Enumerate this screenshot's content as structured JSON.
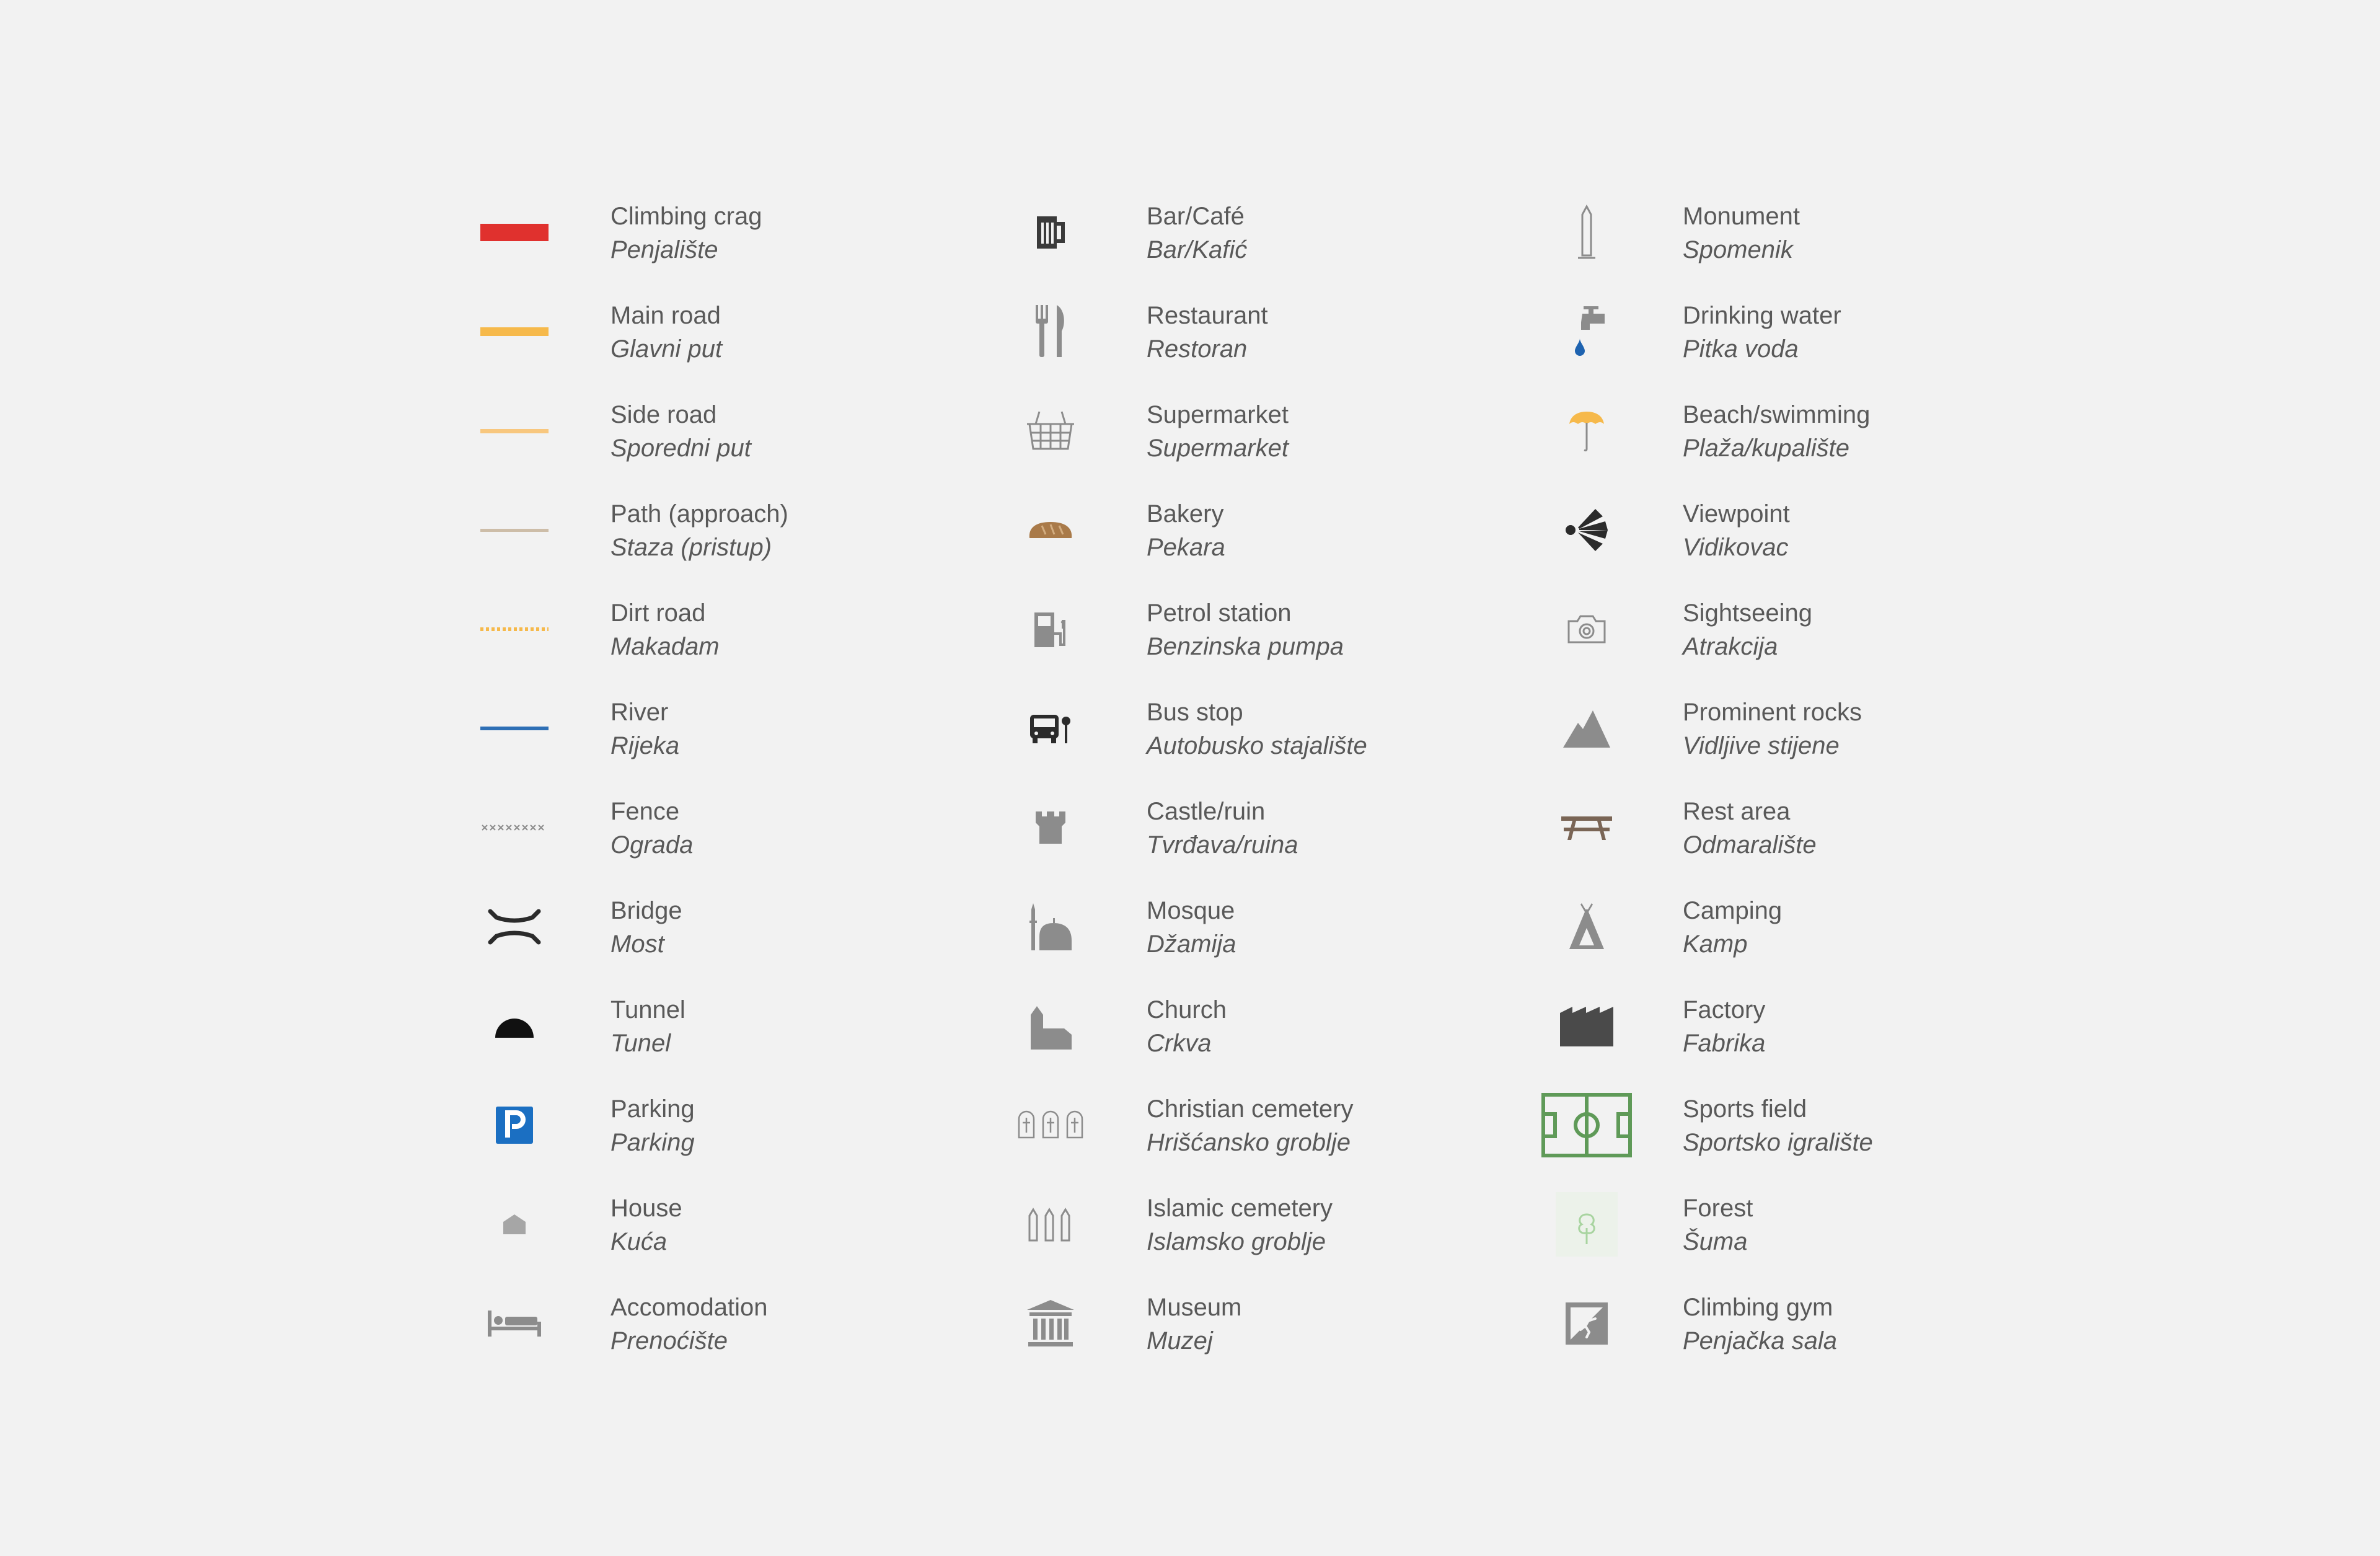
{
  "legend": {
    "columns": [
      [
        {
          "id": "climbing-crag",
          "en": "Climbing crag",
          "hr": "Penjalište",
          "icon": "red-thick-line",
          "color": "#e0312e"
        },
        {
          "id": "main-road",
          "en": "Main road",
          "hr": "Glavni put",
          "icon": "orange-thick-line",
          "color": "#f6b94b"
        },
        {
          "id": "side-road",
          "en": "Side road",
          "hr": "Sporedni put",
          "icon": "light-orange-line",
          "color": "#f8c77e"
        },
        {
          "id": "path",
          "en": "Path (approach)",
          "hr": "Staza (pristup)",
          "icon": "tan-line",
          "color": "#cdbda8"
        },
        {
          "id": "dirt-road",
          "en": "Dirt road",
          "hr": "Makadam",
          "icon": "dotted-orange-line",
          "color": "#f6b94b"
        },
        {
          "id": "river",
          "en": "River",
          "hr": "Rijeka",
          "icon": "blue-line",
          "color": "#2e6fb5"
        },
        {
          "id": "fence",
          "en": "Fence",
          "hr": "Ograda",
          "icon": "cross-line",
          "color": "#8c8c8c"
        },
        {
          "id": "bridge",
          "en": "Bridge",
          "hr": "Most",
          "icon": "bridge-icon",
          "color": "#2b2b2b"
        },
        {
          "id": "tunnel",
          "en": "Tunnel",
          "hr": "Tunel",
          "icon": "tunnel-icon",
          "color": "#111111"
        },
        {
          "id": "parking",
          "en": "Parking",
          "hr": "Parking",
          "icon": "parking-icon",
          "color": "#1b6fc2"
        },
        {
          "id": "house",
          "en": "House",
          "hr": "Kuća",
          "icon": "house-icon",
          "color": "#a6a6a6"
        },
        {
          "id": "accomodation",
          "en": "Accomodation",
          "hr": "Prenoćište",
          "icon": "bed-icon",
          "color": "#8c8c8c"
        }
      ],
      [
        {
          "id": "bar",
          "en": "Bar/Café",
          "hr": "Bar/Kafić",
          "icon": "beer-mug-icon",
          "color": "#3a3a3a"
        },
        {
          "id": "restaurant",
          "en": "Restaurant",
          "hr": "Restoran",
          "icon": "cutlery-icon",
          "color": "#8c8c8c"
        },
        {
          "id": "supermarket",
          "en": "Supermarket",
          "hr": "Supermarket",
          "icon": "basket-icon",
          "color": "#8c8c8c"
        },
        {
          "id": "bakery",
          "en": "Bakery",
          "hr": "Pekara",
          "icon": "bread-icon",
          "color": "#a97a49"
        },
        {
          "id": "petrol",
          "en": "Petrol station",
          "hr": "Benzinska pumpa",
          "icon": "fuel-pump-icon",
          "color": "#8c8c8c"
        },
        {
          "id": "bus-stop",
          "en": "Bus stop",
          "hr": "Autobusko stajalište",
          "icon": "bus-icon",
          "color": "#2b2b2b"
        },
        {
          "id": "castle",
          "en": "Castle/ruin",
          "hr": "Tvrđava/ruina",
          "icon": "castle-icon",
          "color": "#8c8c8c"
        },
        {
          "id": "mosque",
          "en": "Mosque",
          "hr": "Džamija",
          "icon": "mosque-icon",
          "color": "#8c8c8c"
        },
        {
          "id": "church",
          "en": "Church",
          "hr": "Crkva",
          "icon": "church-icon",
          "color": "#8c8c8c"
        },
        {
          "id": "christian-cemetery",
          "en": "Christian cemetery",
          "hr": "Hrišćansko groblje",
          "icon": "cross-graves-icon",
          "color": "#8c8c8c"
        },
        {
          "id": "islamic-cemetery",
          "en": "Islamic cemetery",
          "hr": "Islamsko groblje",
          "icon": "pointed-graves-icon",
          "color": "#8c8c8c"
        },
        {
          "id": "museum",
          "en": "Museum",
          "hr": "Muzej",
          "icon": "museum-icon",
          "color": "#8c8c8c"
        }
      ],
      [
        {
          "id": "monument",
          "en": "Monument",
          "hr": "Spomenik",
          "icon": "obelisk-icon",
          "color": "#8c8c8c"
        },
        {
          "id": "drinking-water",
          "en": "Drinking water",
          "hr": "Pitka voda",
          "icon": "tap-icon",
          "color": "#8c8c8c"
        },
        {
          "id": "beach",
          "en": "Beach/swimming",
          "hr": "Plaža/kupalište",
          "icon": "umbrella-icon",
          "color": "#f6b94b"
        },
        {
          "id": "viewpoint",
          "en": "Viewpoint",
          "hr": "Vidikovac",
          "icon": "viewpoint-icon",
          "color": "#2b2b2b"
        },
        {
          "id": "sightseeing",
          "en": "Sightseeing",
          "hr": "Atrakcija",
          "icon": "camera-icon",
          "color": "#8c8c8c"
        },
        {
          "id": "rocks",
          "en": "Prominent rocks",
          "hr": "Vidljive stijene",
          "icon": "mountain-icon",
          "color": "#8c8c8c"
        },
        {
          "id": "rest-area",
          "en": "Rest area",
          "hr": "Odmaralište",
          "icon": "picnic-table-icon",
          "color": "#7a6555"
        },
        {
          "id": "camping",
          "en": "Camping",
          "hr": "Kamp",
          "icon": "tent-icon",
          "color": "#8c8c8c"
        },
        {
          "id": "factory",
          "en": "Factory",
          "hr": "Fabrika",
          "icon": "factory-icon",
          "color": "#4a4a4a"
        },
        {
          "id": "sports-field",
          "en": "Sports field",
          "hr": "Sportsko igralište",
          "icon": "field-icon",
          "color": "#5f9a58"
        },
        {
          "id": "forest",
          "en": "Forest",
          "hr": "Šuma",
          "icon": "tree-icon",
          "color": "#a8d4a0"
        },
        {
          "id": "climbing-gym",
          "en": "Climbing gym",
          "hr": "Penjačka sala",
          "icon": "climbing-wall-icon",
          "color": "#8c8c8c"
        }
      ]
    ]
  }
}
